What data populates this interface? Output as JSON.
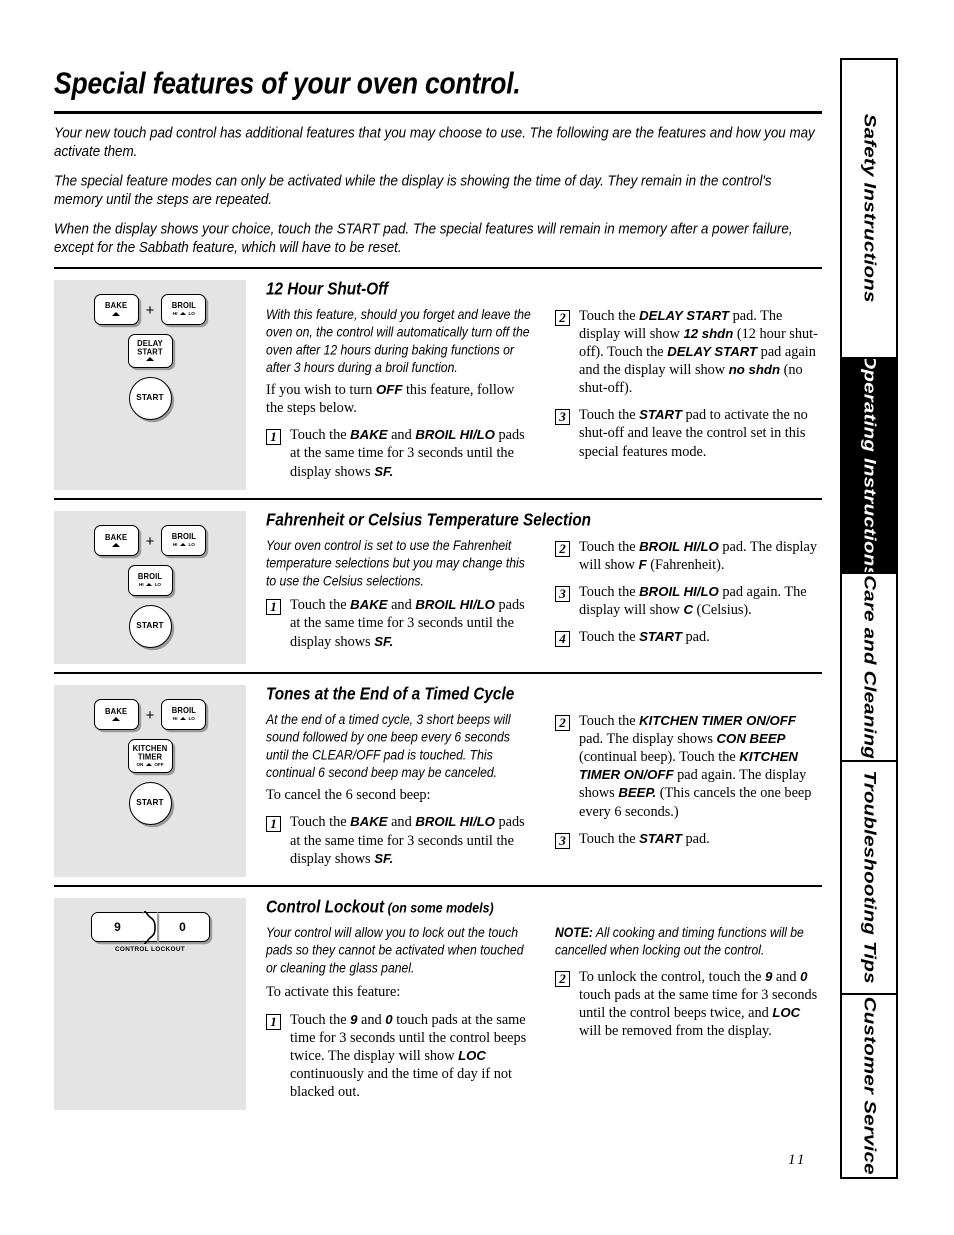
{
  "page": {
    "title": "Special features of your oven control.",
    "number": "11"
  },
  "intro": [
    "Your new touch pad control has additional features that you may choose to use. The following are the features and how you may activate them.",
    "The special feature modes can only be activated while the display is showing the time of day. They remain in the control's memory until the steps are repeated.",
    "When the display shows your choice, touch the START pad. The special features will remain in memory after a power failure, except for the Sabbath feature, which will have to be reset."
  ],
  "tabs": [
    {
      "label": "Safety Instructions",
      "active": false
    },
    {
      "label": "Operating Instructions",
      "active": true
    },
    {
      "label": "Care and Cleaning",
      "active": false
    },
    {
      "label": "Troubleshooting Tips",
      "active": false
    },
    {
      "label": "Customer Service",
      "active": false
    }
  ],
  "pads": {
    "bake": "BAKE",
    "broil": "BROIL",
    "broil_hi": "HI",
    "broil_lo": "LO",
    "delay_start_1": "DELAY",
    "delay_start_2": "START",
    "kitchen_timer_1": "KITCHEN",
    "kitchen_timer_2": "TIMER",
    "kitchen_on": "ON",
    "kitchen_off": "OFF",
    "start": "START",
    "plus": "+",
    "lock_nine": "9",
    "lock_zero": "0",
    "lock_caption": "CONTROL LOCKOUT"
  },
  "sections": [
    {
      "heading": "12 Hour Shut-Off",
      "heading_sub": "",
      "intro_italic": "With this feature, should you forget and leave the oven on, the control will automatically turn off the oven after 12 hours during baking functions or after 3 hours during a broil function.",
      "lead_pre": "If you wish to turn ",
      "lead_bold": "OFF",
      "lead_post": " this feature, follow the steps below.",
      "left_steps": [
        {
          "num": "1",
          "parts": [
            {
              "t": "Touch the ",
              "b": false
            },
            {
              "t": "BAKE",
              "b": true
            },
            {
              "t": " and ",
              "b": false
            },
            {
              "t": "BROIL HI/LO",
              "b": true
            },
            {
              "t": " pads at the same time for 3 seconds until the display shows ",
              "b": false
            },
            {
              "t": "SF.",
              "b": true
            }
          ]
        }
      ],
      "right_steps": [
        {
          "num": "2",
          "parts": [
            {
              "t": "Touch the ",
              "b": false
            },
            {
              "t": "DELAY START",
              "b": true
            },
            {
              "t": " pad. The display will show ",
              "b": false
            },
            {
              "t": "12 shdn",
              "b": true
            },
            {
              "t": " (12 hour shut-off). Touch the ",
              "b": false
            },
            {
              "t": "DELAY START",
              "b": true
            },
            {
              "t": " pad again and the display will show ",
              "b": false
            },
            {
              "t": "no shdn",
              "b": true
            },
            {
              "t": " (no shut-off).",
              "b": false
            }
          ]
        },
        {
          "num": "3",
          "parts": [
            {
              "t": "Touch the ",
              "b": false
            },
            {
              "t": "START",
              "b": true
            },
            {
              "t": " pad to activate the no shut-off and leave the control set in this special features mode.",
              "b": false
            }
          ]
        }
      ]
    },
    {
      "heading": "Fahrenheit or Celsius Temperature Selection",
      "heading_sub": "",
      "intro_italic": "Your oven control is set to use the Fahrenheit temperature selections but you may change this to use the Celsius selections.",
      "lead_pre": "",
      "lead_bold": "",
      "lead_post": "",
      "left_steps": [
        {
          "num": "1",
          "parts": [
            {
              "t": "Touch the ",
              "b": false
            },
            {
              "t": "BAKE",
              "b": true
            },
            {
              "t": " and ",
              "b": false
            },
            {
              "t": "BROIL HI/LO",
              "b": true
            },
            {
              "t": " pads at the same time for 3 seconds until the display shows ",
              "b": false
            },
            {
              "t": "SF.",
              "b": true
            }
          ]
        }
      ],
      "right_steps": [
        {
          "num": "2",
          "parts": [
            {
              "t": "Touch the ",
              "b": false
            },
            {
              "t": "BROIL HI/LO",
              "b": true
            },
            {
              "t": " pad. The display will show ",
              "b": false
            },
            {
              "t": "F",
              "b": true
            },
            {
              "t": " (Fahrenheit).",
              "b": false
            }
          ]
        },
        {
          "num": "3",
          "parts": [
            {
              "t": "Touch the ",
              "b": false
            },
            {
              "t": "BROIL HI/LO",
              "b": true
            },
            {
              "t": " pad again. The display will show ",
              "b": false
            },
            {
              "t": "C",
              "b": true
            },
            {
              "t": " (Celsius).",
              "b": false
            }
          ]
        },
        {
          "num": "4",
          "parts": [
            {
              "t": "Touch the ",
              "b": false
            },
            {
              "t": "START",
              "b": true
            },
            {
              "t": " pad.",
              "b": false
            }
          ]
        }
      ]
    },
    {
      "heading": "Tones at the End of a Timed Cycle",
      "heading_sub": "",
      "intro_italic": "At the end of a timed cycle, 3 short beeps will sound followed by one beep every 6 seconds until the CLEAR/OFF pad is touched. This continual 6 second beep may be canceled.",
      "lead_pre": "To cancel the 6 second beep:",
      "lead_bold": "",
      "lead_post": "",
      "left_steps": [
        {
          "num": "1",
          "parts": [
            {
              "t": "Touch the ",
              "b": false
            },
            {
              "t": "BAKE",
              "b": true
            },
            {
              "t": " and ",
              "b": false
            },
            {
              "t": "BROIL HI/LO",
              "b": true
            },
            {
              "t": " pads at the same time for 3 seconds until the display shows ",
              "b": false
            },
            {
              "t": "SF.",
              "b": true
            }
          ]
        }
      ],
      "right_steps": [
        {
          "num": "2",
          "parts": [
            {
              "t": "Touch the ",
              "b": false
            },
            {
              "t": "KITCHEN TIMER ON/OFF",
              "b": true
            },
            {
              "t": " pad. The display shows ",
              "b": false
            },
            {
              "t": "CON BEEP",
              "b": true
            },
            {
              "t": " (continual beep). Touch the ",
              "b": false
            },
            {
              "t": "KITCHEN TIMER ON/OFF",
              "b": true
            },
            {
              "t": " pad again. The display shows ",
              "b": false
            },
            {
              "t": "BEEP.",
              "b": true
            },
            {
              "t": " (This cancels the one beep every 6 seconds.)",
              "b": false
            }
          ]
        },
        {
          "num": "3",
          "parts": [
            {
              "t": "Touch the ",
              "b": false
            },
            {
              "t": "START",
              "b": true
            },
            {
              "t": " pad.",
              "b": false
            }
          ]
        }
      ]
    },
    {
      "heading": "Control Lockout",
      "heading_sub": " (on some models)",
      "intro_italic": "Your control will allow you to lock out the touch pads so they cannot be activated when touched or cleaning the glass panel.",
      "lead_pre": "To activate this feature:",
      "lead_bold": "",
      "lead_post": "",
      "note_label": "NOTE:",
      "note_text": " All cooking and timing functions will be cancelled when locking out the control.",
      "left_steps": [
        {
          "num": "1",
          "parts": [
            {
              "t": "Touch the ",
              "b": false
            },
            {
              "t": "9",
              "b": true
            },
            {
              "t": " and ",
              "b": false
            },
            {
              "t": "0",
              "b": true
            },
            {
              "t": " touch pads at the same time for 3 seconds until the control beeps twice. The display will show ",
              "b": false
            },
            {
              "t": "LOC",
              "b": true
            },
            {
              "t": " continuously and the time of day if not blacked out.",
              "b": false
            }
          ]
        }
      ],
      "right_steps": [
        {
          "num": "2",
          "parts": [
            {
              "t": "To unlock the control, touch the ",
              "b": false
            },
            {
              "t": "9",
              "b": true
            },
            {
              "t": " and ",
              "b": false
            },
            {
              "t": "0",
              "b": true
            },
            {
              "t": " touch pads at the same time for 3 seconds until the control beeps twice, and ",
              "b": false
            },
            {
              "t": "LOC",
              "b": true
            },
            {
              "t": " will be removed from the display.",
              "b": false
            }
          ]
        }
      ]
    }
  ]
}
